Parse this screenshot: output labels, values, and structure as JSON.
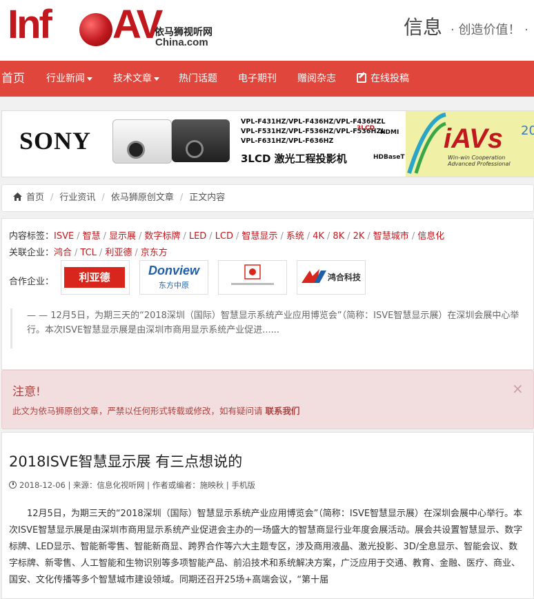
{
  "header": {
    "logo": {
      "info": "Inf",
      "av": "AV",
      "cn": "依马狮视听网",
      "domain": "China.com"
    },
    "title": "信息",
    "slogan": "· 创造价值！ ·"
  },
  "nav": {
    "home": "首页",
    "items": [
      "行业新闻",
      "技术文章",
      "热门话题",
      "电子期刊",
      "赠阅杂志",
      "在线投稿"
    ]
  },
  "banner": {
    "brand": "SONY",
    "models": "VPL-F431HZ/VPL-F436HZ/VPL-F436HZL\nVPL-F531HZ/VPL-F536HZ/VPL-F536HZL\nVPL-F631HZ/VPL-F636HZ",
    "product": "3LCD 激光工程投影机",
    "badges": [
      "3LCD",
      "HDMI",
      "HDBaseT"
    ],
    "ivs": "iAVs",
    "ivs_sub": "Win-win Cooperation\nAdvanced Professional",
    "year": "20"
  },
  "breadcrumb": [
    "首页",
    "行业资讯",
    "依马狮原创文章",
    "正文内容"
  ],
  "tags": {
    "label": "内容标签：",
    "items": [
      "ISVE",
      "智慧",
      "显示展",
      "数字标牌",
      "LED",
      "LCD",
      "智慧显示",
      "系统",
      "4K",
      "8K",
      "2K",
      "智慧城市",
      "信息化"
    ]
  },
  "companies": {
    "label": "关联企业：",
    "items": [
      "鸿合",
      "TCL",
      "利亚德",
      "京东方"
    ]
  },
  "partners": {
    "label": "合作企业：",
    "logos": [
      "利亚德",
      "Donview",
      "东方中原",
      "鸿合科技"
    ]
  },
  "summary": "— — 12月5日，为期三天的“2018深圳（国际）智慧显示系统产业应用博览会”（简称：ISVE智慧显示展）在深圳会展中心举行。本次ISVE智慧显示展是由深圳市商用显示系统产业促进......",
  "alert": {
    "title": "注意!",
    "text": "此文为依马狮原创文章，严禁以任何形式转载或修改，如有疑问请",
    "link": "联系我们",
    "close": "×"
  },
  "article": {
    "title": "2018ISVE智慧显示展 有三点想说的",
    "meta": "2018-12-06 | 来源：信息化视听网 | 作者或编者：施映秋 | 手机版",
    "body": "12月5日，为期三天的“2018深圳（国际）智慧显示系统产业应用博览会”（简称：ISVE智慧显示展）在深圳会展中心举行。本次ISVE智慧显示展是由深圳市商用显示系统产业促进会主办的一场盛大的智慧商显行业年度会展活动。展会共设置智慧显示、数字标牌、LED显示、智能新零售、智能新商显、跨界合作等六大主题专区，涉及商用液晶、激光投影、3D/全息显示、智能会议、数字标牌、新零售、人工智能和生物识别等多项智能产品、前沿技术和系统解决方案，广泛应用于交通、教育、金融、医疗、商业、国安、文化传播等多个智慧城市建设领域。同期还召开25场+高端会议，“第十届"
  }
}
